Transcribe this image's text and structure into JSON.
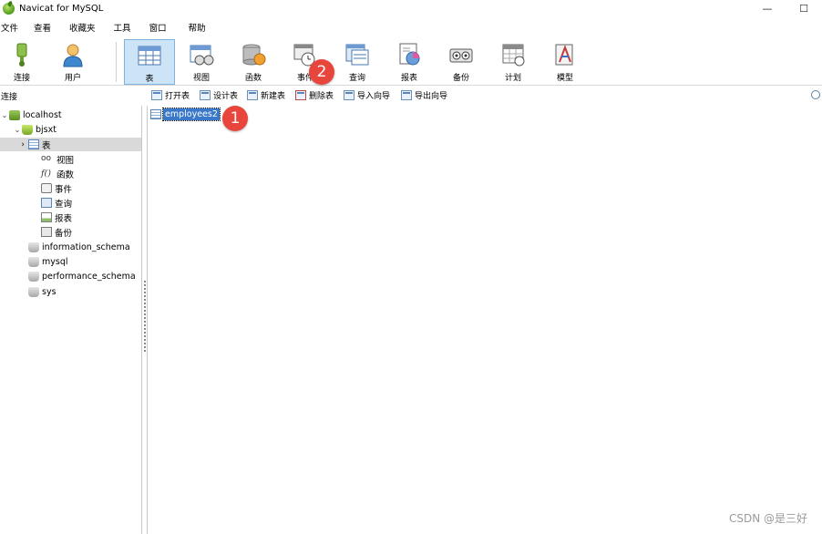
{
  "window": {
    "title": "Navicat for MySQL",
    "minimize": "—",
    "maximize": "☐"
  },
  "menu": [
    "文件",
    "查看",
    "收藏夹",
    "工具",
    "窗口",
    "帮助"
  ],
  "toolbar": [
    {
      "label": "连接",
      "icon": "connection-icon"
    },
    {
      "label": "用户",
      "icon": "user-icon"
    },
    {
      "label": "表",
      "icon": "table-icon",
      "active": true
    },
    {
      "label": "视图",
      "icon": "view-icon"
    },
    {
      "label": "函数",
      "icon": "function-icon"
    },
    {
      "label": "事件",
      "icon": "event-icon"
    },
    {
      "label": "查询",
      "icon": "query-icon"
    },
    {
      "label": "报表",
      "icon": "report-icon"
    },
    {
      "label": "备份",
      "icon": "backup-icon"
    },
    {
      "label": "计划",
      "icon": "schedule-icon"
    },
    {
      "label": "模型",
      "icon": "model-icon"
    }
  ],
  "objbar": {
    "panel_label": "连接",
    "buttons": [
      "打开表",
      "设计表",
      "新建表",
      "删除表",
      "导入向导",
      "导出向导"
    ]
  },
  "tree": {
    "connection": "localhost",
    "database": "bjsxt",
    "nodes": [
      "表",
      "视图",
      "函数",
      "事件",
      "查询",
      "报表",
      "备份"
    ],
    "func_glyph": "f()",
    "view_glyph": "oo",
    "other_databases": [
      "information_schema",
      "mysql",
      "performance_schema",
      "sys"
    ]
  },
  "tables": [
    "employees2"
  ],
  "annotations": {
    "badge1": "1",
    "badge2": "2"
  },
  "watermark": "CSDN @是三好",
  "colors": {
    "accent": "#3a78c9",
    "badge": "#e8453c",
    "active_tool": "#cde4f7"
  }
}
